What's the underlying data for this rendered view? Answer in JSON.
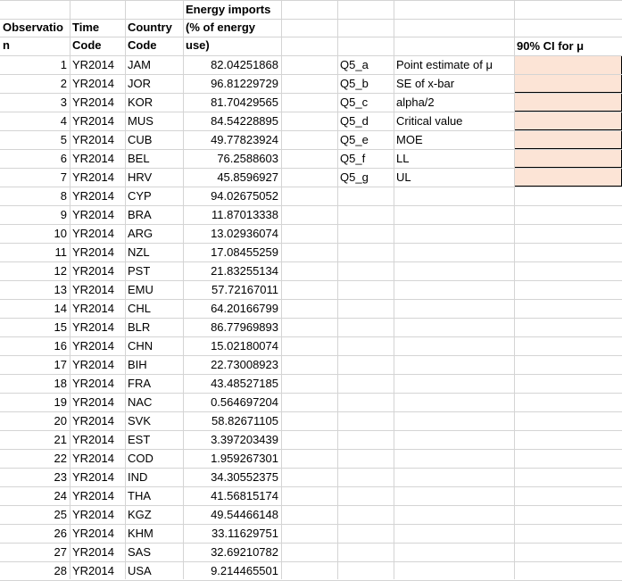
{
  "headers": {
    "col_a": [
      "Observatio",
      "n"
    ],
    "col_b": [
      "Time",
      "Code"
    ],
    "col_c": [
      "Country",
      "Code"
    ],
    "col_d": [
      "Energy imports",
      "(% of energy",
      "use)"
    ],
    "ci_title": "90% CI for μ"
  },
  "rows": [
    {
      "obs": "1",
      "time": "YR2014",
      "country": "JAM",
      "value": "82.04251868"
    },
    {
      "obs": "2",
      "time": "YR2014",
      "country": "JOR",
      "value": "96.81229729"
    },
    {
      "obs": "3",
      "time": "YR2014",
      "country": "KOR",
      "value": "81.70429565"
    },
    {
      "obs": "4",
      "time": "YR2014",
      "country": "MUS",
      "value": "84.54228895"
    },
    {
      "obs": "5",
      "time": "YR2014",
      "country": "CUB",
      "value": "49.77823924"
    },
    {
      "obs": "6",
      "time": "YR2014",
      "country": "BEL",
      "value": "76.2588603"
    },
    {
      "obs": "7",
      "time": "YR2014",
      "country": "HRV",
      "value": "45.8596927"
    },
    {
      "obs": "8",
      "time": "YR2014",
      "country": "CYP",
      "value": "94.02675052"
    },
    {
      "obs": "9",
      "time": "YR2014",
      "country": "BRA",
      "value": "11.87013338"
    },
    {
      "obs": "10",
      "time": "YR2014",
      "country": "ARG",
      "value": "13.02936074"
    },
    {
      "obs": "11",
      "time": "YR2014",
      "country": "NZL",
      "value": "17.08455259"
    },
    {
      "obs": "12",
      "time": "YR2014",
      "country": "PST",
      "value": "21.83255134"
    },
    {
      "obs": "13",
      "time": "YR2014",
      "country": "EMU",
      "value": "57.72167011"
    },
    {
      "obs": "14",
      "time": "YR2014",
      "country": "CHL",
      "value": "64.20166799"
    },
    {
      "obs": "15",
      "time": "YR2014",
      "country": "BLR",
      "value": "86.77969893"
    },
    {
      "obs": "16",
      "time": "YR2014",
      "country": "CHN",
      "value": "15.02180074"
    },
    {
      "obs": "17",
      "time": "YR2014",
      "country": "BIH",
      "value": "22.73008923"
    },
    {
      "obs": "18",
      "time": "YR2014",
      "country": "FRA",
      "value": "43.48527185"
    },
    {
      "obs": "19",
      "time": "YR2014",
      "country": "NAC",
      "value": "0.564697204"
    },
    {
      "obs": "20",
      "time": "YR2014",
      "country": "SVK",
      "value": "58.82671105"
    },
    {
      "obs": "21",
      "time": "YR2014",
      "country": "EST",
      "value": "3.397203439"
    },
    {
      "obs": "22",
      "time": "YR2014",
      "country": "COD",
      "value": "1.959267301"
    },
    {
      "obs": "23",
      "time": "YR2014",
      "country": "IND",
      "value": "34.30552375"
    },
    {
      "obs": "24",
      "time": "YR2014",
      "country": "THA",
      "value": "41.56815174"
    },
    {
      "obs": "25",
      "time": "YR2014",
      "country": "KGZ",
      "value": "49.54466148"
    },
    {
      "obs": "26",
      "time": "YR2014",
      "country": "KHM",
      "value": "33.11629751"
    },
    {
      "obs": "27",
      "time": "YR2014",
      "country": "SAS",
      "value": "32.69210782"
    },
    {
      "obs": "28",
      "time": "YR2014",
      "country": "USA",
      "value": "9.214465501"
    }
  ],
  "questions": [
    {
      "code": "Q5_a",
      "label": "Point estimate of μ"
    },
    {
      "code": "Q5_b",
      "label": "SE of x-bar"
    },
    {
      "code": "Q5_c",
      "label": "alpha/2"
    },
    {
      "code": "Q5_d",
      "label": "Critical value"
    },
    {
      "code": "Q5_e",
      "label": "MOE"
    },
    {
      "code": "Q5_f",
      "label": "LL"
    },
    {
      "code": "Q5_g",
      "label": "UL"
    }
  ],
  "colors": {
    "answer_fill": "#fce4d6",
    "gridline": "#d4d4d4"
  }
}
